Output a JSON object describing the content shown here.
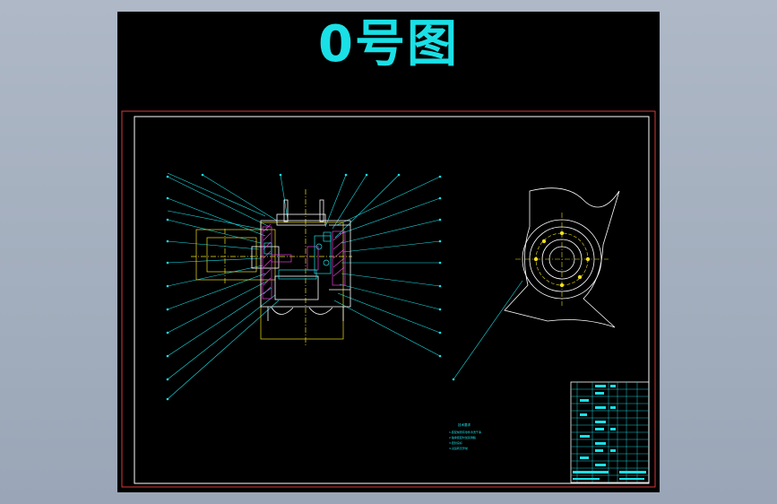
{
  "drawing": {
    "title": "0号图",
    "notes_heading": "技术要求",
    "notes": [
      "1.装配前所有零件清洗干净",
      "2.轴承装配时加润滑脂",
      "3.密封良好",
      "4.试运转无异常"
    ]
  },
  "colors": {
    "background": "#000000",
    "canvas_frame": "#a9b3c1",
    "outer_border": "#d93a3a",
    "inner_border": "#ffffff",
    "leader": "#19e0e6",
    "part": "#ffffff",
    "hatch": "#e53fd9",
    "center": "#f0e01c",
    "title_text": "#19e0e6"
  }
}
